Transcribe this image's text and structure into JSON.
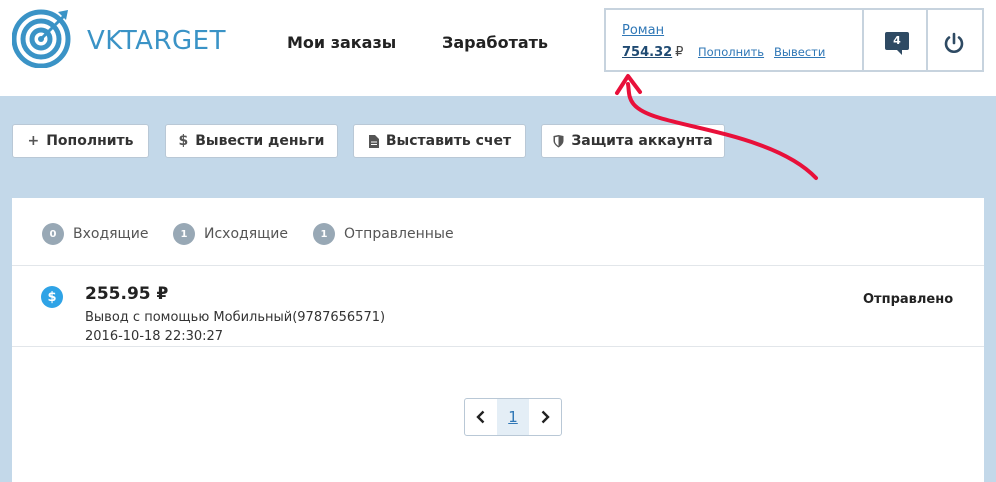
{
  "header": {
    "logo_text": "VKTARGET",
    "nav": [
      {
        "label": "Мои заказы"
      },
      {
        "label": "Заработать"
      }
    ],
    "user": {
      "name": "Роман",
      "balance": "754.32",
      "currency": "₽",
      "topup_link": "Пополнить",
      "withdraw_link": "Вывести"
    },
    "messages_count": "4",
    "icons": {
      "messages": "chat-bubble-icon",
      "logout": "power-icon",
      "logo": "target-icon"
    }
  },
  "actions": [
    {
      "icon": "+",
      "label": "Пополнить"
    },
    {
      "icon": "$",
      "label": "Вывести деньги"
    },
    {
      "icon": "document-icon",
      "label": "Выставить счет"
    },
    {
      "icon": "shield-icon",
      "label": "Защита аккаунта"
    }
  ],
  "tabs": [
    {
      "count": "0",
      "label": "Входящие"
    },
    {
      "count": "1",
      "label": "Исходящие"
    },
    {
      "count": "1",
      "label": "Отправленные"
    }
  ],
  "transactions": [
    {
      "icon": "$",
      "amount": "255.95 ₽",
      "description": "Вывод с помощью Мобильный(9787656571)",
      "date": "2016-10-18 22:30:27",
      "status": "Отправлено"
    }
  ],
  "pagination": {
    "current": "1"
  },
  "colors": {
    "accent": "#3a93c6",
    "background": "#c3d8e9",
    "annotation_arrow": "#e8103a",
    "badge": "#98a8b5"
  }
}
